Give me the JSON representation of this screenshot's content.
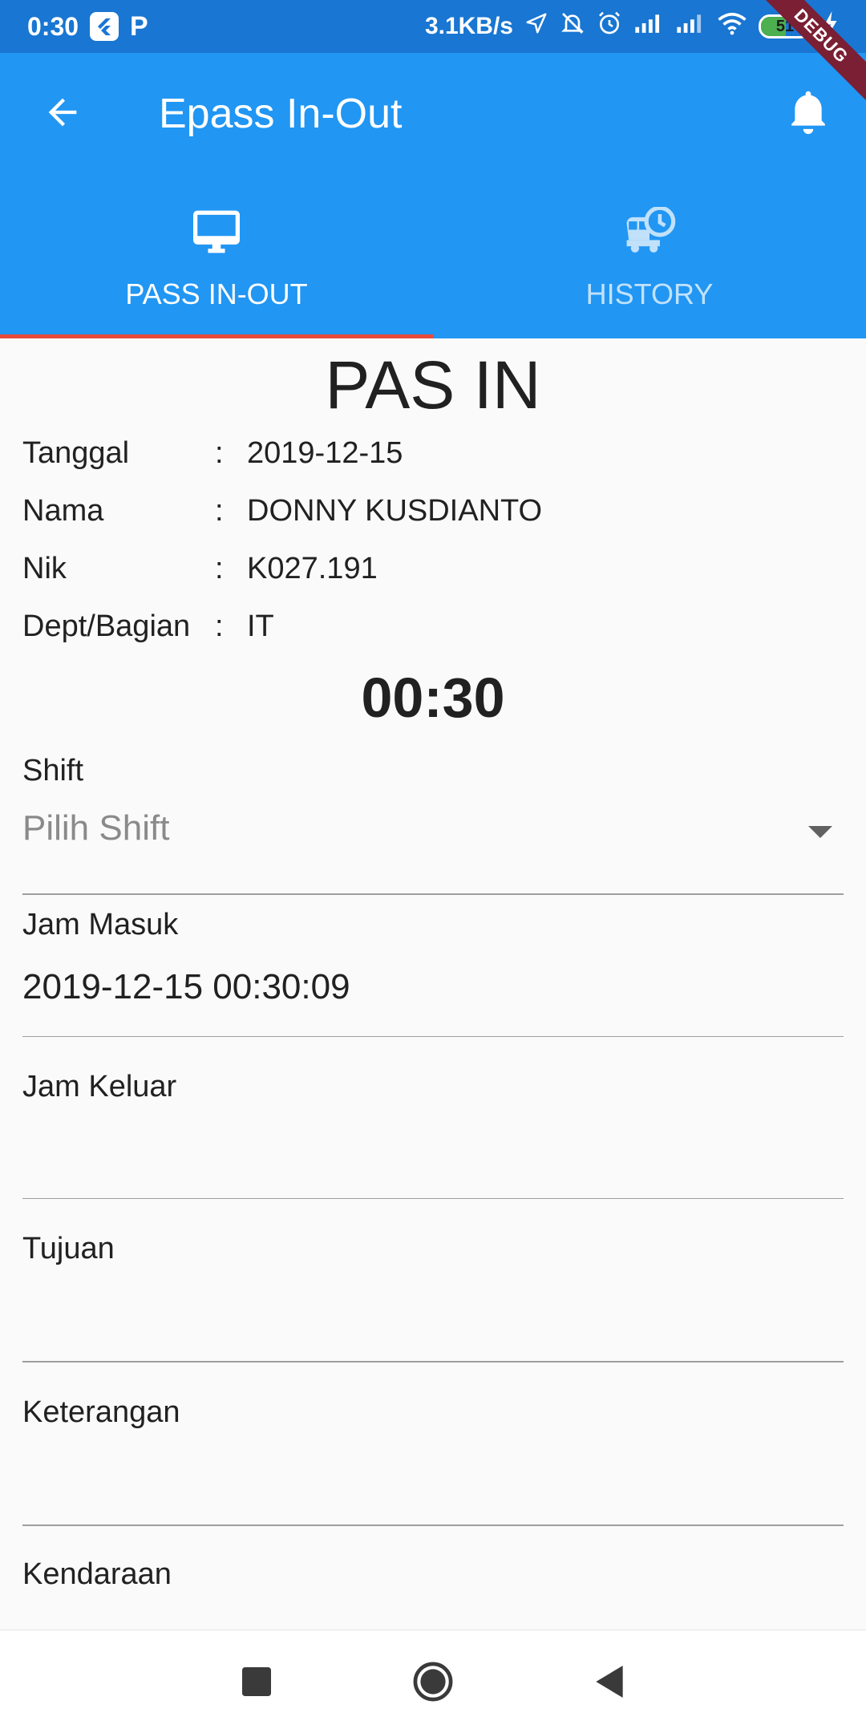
{
  "status_bar": {
    "time": "0:30",
    "net_speed": "3.1KB/s",
    "battery": "51",
    "battery_level": 0.51,
    "icons": [
      "flutter-app-icon",
      "p-app-icon",
      "location-icon",
      "mute-icon",
      "alarm-icon",
      "signal-icon",
      "signal-icon",
      "wifi-icon",
      "battery-icon",
      "charging-icon"
    ]
  },
  "debug_banner": "DEBUG",
  "app_bar": {
    "title": "Epass In-Out",
    "back_icon": "arrow-back-icon",
    "bell_icon": "bell-icon",
    "color": "#2196f3"
  },
  "tabs": [
    {
      "label": "PASS IN-OUT",
      "icon": "desktop-icon",
      "active": true
    },
    {
      "label": "HISTORY",
      "icon": "bus-clock-icon",
      "active": false
    }
  ],
  "indicator_color": "#e64a3b",
  "form": {
    "heading": "PAS IN",
    "info": [
      {
        "label": "Tanggal",
        "sep": ":",
        "value": "2019-12-15"
      },
      {
        "label": "Nama",
        "sep": ":",
        "value": "DONNY KUSDIANTO"
      },
      {
        "label": "Nik",
        "sep": ":",
        "value": "K027.191"
      },
      {
        "label": "Dept/Bagian",
        "sep": ":",
        "value": "IT"
      }
    ],
    "clock": "00:30",
    "shift": {
      "label": "Shift",
      "placeholder": "Pilih Shift"
    },
    "jam_masuk": {
      "label": "Jam Masuk",
      "value": "2019-12-15 00:30:09"
    },
    "jam_keluar": {
      "label": "Jam Keluar",
      "value": ""
    },
    "tujuan": {
      "label": "Tujuan",
      "value": ""
    },
    "keterangan": {
      "label": "Keterangan",
      "value": ""
    },
    "kendaraan": {
      "label": "Kendaraan"
    }
  },
  "nav": [
    "stop-square-icon",
    "home-circle-icon",
    "back-triangle-icon"
  ]
}
